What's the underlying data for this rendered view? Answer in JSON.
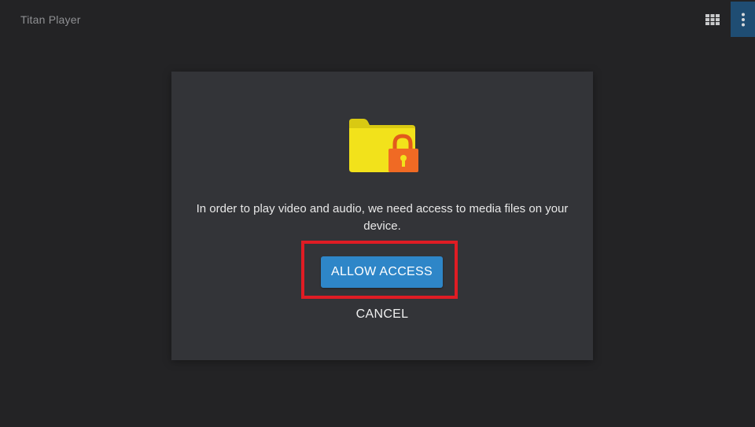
{
  "app": {
    "title": "Titan Player"
  },
  "toolbar": {
    "grid_icon": "grid-view-icon",
    "menu_icon": "more-vert-icon"
  },
  "dialog": {
    "icon": "folder-lock-icon",
    "message": "In order to play video and audio, we need access to media files on your device.",
    "allow_label": "ALLOW ACCESS",
    "cancel_label": "CANCEL"
  },
  "colors": {
    "background": "#232325",
    "dialog_background": "#333438",
    "accent_button": "#2e86c8",
    "highlight_border": "#e01c24",
    "menu_active": "#1f4d73",
    "folder": "#f2e21b",
    "lock": "#f06a24"
  }
}
